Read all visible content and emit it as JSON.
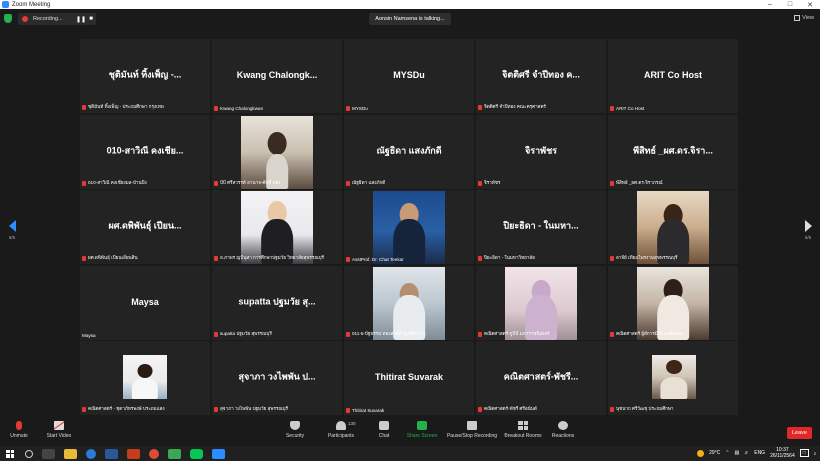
{
  "window": {
    "title": "Zoom Meeting"
  },
  "topbar": {
    "recording_label": "Recording...",
    "talking_label": "Aonsin Namsena is talking...",
    "view_label": "View"
  },
  "gallery": {
    "page_indicator": "5/5",
    "row1": [
      {
        "display": "ชุติมันท์ ทิ้งเพ็ญ -...",
        "label": "ชุติมันท์ ทิ้งเพ็ญ - ประถมศึกษา กรุงเทพ"
      },
      {
        "display": "Kwang  Chalongk...",
        "label": "Kwang Chalongkwan"
      },
      {
        "display": "MYSDu",
        "label": "MYSDu"
      },
      {
        "display": "จิตติศรี จำปีทอง ค...",
        "label": "จิตติศรี จำปีทอง คณะครุศาสตร์"
      },
      {
        "display": "ARIT Co Host",
        "label": "ARIT Co Host"
      }
    ],
    "row2": [
      {
        "display": "010-สาวิณี คงเชีย...",
        "label": "010-สาวิณี คงเชียงมล-บ้านบึง"
      },
      {
        "display": "",
        "label": "บีบี ศรีสวรรค์ อานาจ-ศักดิ์ ทอง"
      },
      {
        "display": "ณัฐธิดา แสงภักดี",
        "label": "ณัฐธิดา แสงภักดี"
      },
      {
        "display": "จิราพัชร",
        "label": "จิราพัชร"
      },
      {
        "display": "พีสิทธ์ _ผศ.ดร.จิรา...",
        "label": "พีสิทธ์ _ผศ.ดร.จิราภรณ์"
      }
    ],
    "row3": [
      {
        "display": "ผศ.ดพิพันธุ์ เปียน...",
        "label": "ผศ.ดพิพันธุ์ เปียนเลี่ยนสิน"
      },
      {
        "display": "",
        "label": "อ.ภาพร ญบีนุสา การศึกษาปฐมวัย วิทยาลัยสุพรรณบุรี"
      },
      {
        "display": "",
        "label": "AsstProf. Dr. Chat Teekar"
      },
      {
        "display": "ปิยะธิดา - ในมหา...",
        "label": "ปิยะธิดา - ในมหาวิทยาลัย"
      },
      {
        "display": "",
        "label": "อาจีย์ เทียมไพรงามสุขพรรณบุรี"
      }
    ],
    "row4": [
      {
        "display": "Maysa",
        "label": "Maysa"
      },
      {
        "display": "supatta ปฐมวัย สุ...",
        "label": "supatta ปฐมวัย สุพรรณบุรี"
      },
      {
        "display": "",
        "label": "011-5-ปัฐธรรม ทองสวัสดิ์-ศูนย์ทำงาน"
      },
      {
        "display": "",
        "label": "คณิตศาสตร์-กูปีนี มหาราชนิเตอร์"
      },
      {
        "display": "",
        "label": "คณิตศาสตร์ ผู้สัการมีนักมนยิมเมอ"
      }
    ],
    "row5": [
      {
        "display": "",
        "label": "คณิตศาสตร์ - ชุตาภัทรพงษ์ ประถมแสง"
      },
      {
        "display": "สุจาภา วงไพพัน ป...",
        "label": "สุจาภา วงไพพัน ปฐมวัย สุพรรณบุรี"
      },
      {
        "display": "Thitirat Suvarak",
        "label": "Thitirat Suvarak"
      },
      {
        "display": "คณิตศาสตร์-พัชรี...",
        "label": "คณิตศาสตร์-พัชรี ศรีอนันต์"
      },
      {
        "display": "",
        "label": "นุชนาถ ศรีวัฒชุ ประถมศึกษา"
      }
    ]
  },
  "toolbar": {
    "unmute": "Unmute",
    "start_video": "Start Video",
    "security": "Security",
    "participants": "Participants",
    "participants_count": "130",
    "chat": "Chat",
    "share_screen": "Share Screen",
    "pause_recording": "Pause/Stop Recording",
    "breakout_rooms": "Breakout Rooms",
    "reactions": "Reactions",
    "leave": "Leave"
  },
  "taskbar": {
    "temperature": "29°C",
    "language": "ENG",
    "time": "10:37",
    "date": "26/11/2564",
    "notification_count": "2"
  },
  "colors": {
    "accent": "#2d8cff",
    "leave": "#e02828",
    "record": "#e53935",
    "share": "#22b14c"
  }
}
